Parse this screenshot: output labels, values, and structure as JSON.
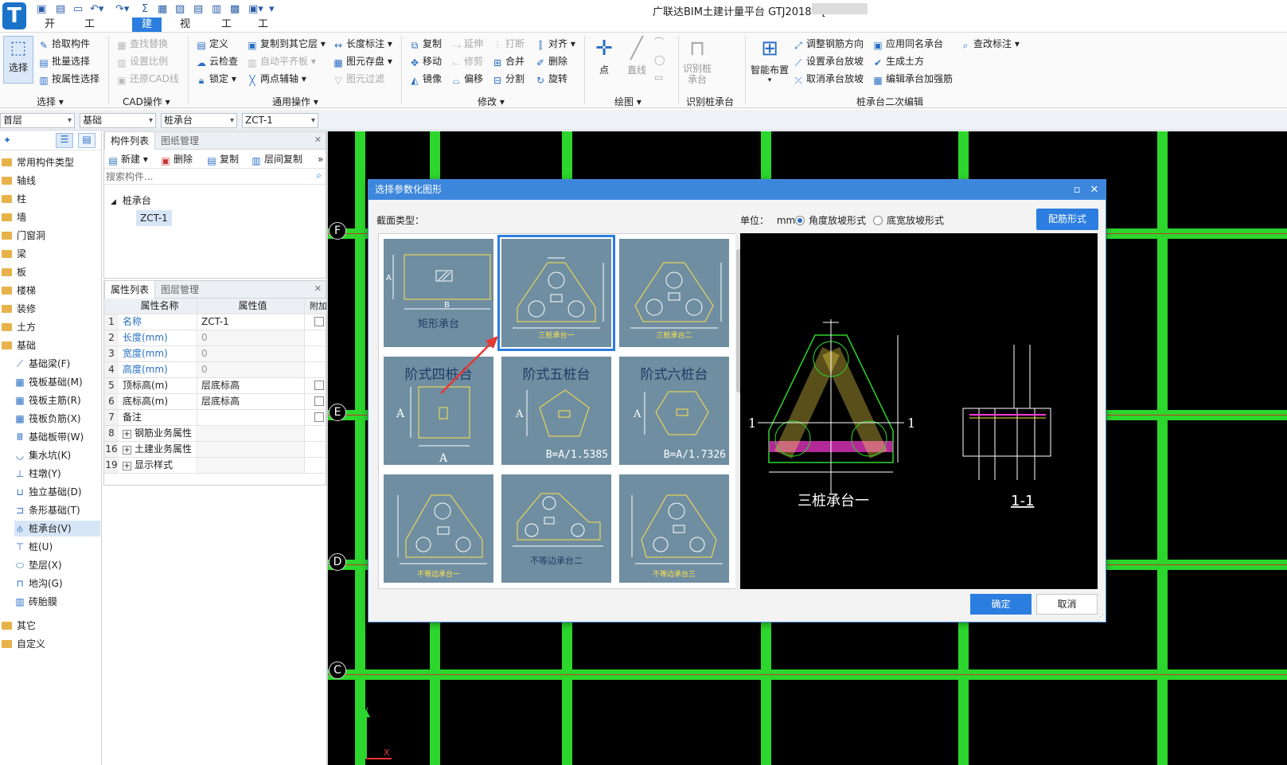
{
  "window": {
    "title": "广联达BIM土建计量平台 GTJ2018 - [",
    "logo": "T"
  },
  "menu": [
    "开始",
    "工程设置",
    "建模",
    "视图",
    "工具",
    "工程量"
  ],
  "menu_active": "建模",
  "ribbon": {
    "select": {
      "label": "选择",
      "pick": "拾取构件",
      "batch": "批量选择",
      "by_prop": "按属性选择",
      "group": "选择"
    },
    "cad": {
      "find_replace": "查找替换",
      "set_scale": "设置比例",
      "restore_cad": "还原CAD线",
      "group": "CAD操作"
    },
    "common": {
      "define": "定义",
      "cloud_check": "云检查",
      "lock": "锁定",
      "copy_layer": "复制到其它层",
      "auto_level": "自动平齐板",
      "two_point_axis": "两点辅轴",
      "len_mark": "长度标注",
      "save_elem": "图元存盘",
      "elem_filter": "图元过滤",
      "group": "通用操作"
    },
    "modify": {
      "copy": "复制",
      "move": "移动",
      "mirror": "镜像",
      "extend": "延伸",
      "trim": "修剪",
      "offset": "偏移",
      "break": "打断",
      "merge": "合并",
      "split": "分割",
      "align": "对齐",
      "delete": "删除",
      "rotate": "旋转",
      "group": "修改"
    },
    "draw": {
      "point": "点",
      "line": "直线",
      "group": "绘图"
    },
    "identify": {
      "label": "识别桩承台",
      "group": "识别桩承台"
    },
    "secondary": {
      "smart": "智能布置",
      "adjust_rebar": "调整钢筋方向",
      "set_slope": "设置承台放坡",
      "cancel_slope": "取消承台放坡",
      "apply_same": "应用同名承台",
      "gen_earth": "生成土方",
      "edit_reinf": "编辑承台加强筋",
      "view_mark": "查改标注",
      "group": "桩承台二次编辑"
    }
  },
  "selectors": [
    "首层",
    "基础",
    "桩承台",
    "ZCT-1"
  ],
  "tree": [
    "常用构件类型",
    "轴线",
    "柱",
    "墙",
    "门窗洞",
    "梁",
    "板",
    "楼梯",
    "装修",
    "土方",
    "基础",
    "基础梁(F)",
    "筏板基础(M)",
    "筏板主筋(R)",
    "筏板负筋(X)",
    "基础板带(W)",
    "集水坑(K)",
    "柱墩(Y)",
    "独立基础(D)",
    "条形基础(T)",
    "桩承台(V)",
    "桩(U)",
    "垫层(X)",
    "地沟(G)",
    "砖胎膜",
    "其它",
    "自定义"
  ],
  "component_panel": {
    "tab1": "构件列表",
    "tab2": "图纸管理",
    "new": "新建",
    "del": "删除",
    "copy": "复制",
    "layer_copy": "层间复制",
    "search_ph": "搜索构件...",
    "node": "桩承台",
    "leaf": "ZCT-1"
  },
  "prop_panel": {
    "tab1": "属性列表",
    "tab2": "图层管理",
    "headers": [
      "属性名称",
      "属性值",
      "附加"
    ],
    "rows": [
      {
        "idx": "1",
        "name": "名称",
        "value": "ZCT-1"
      },
      {
        "idx": "2",
        "name": "长度(mm)",
        "value": "0"
      },
      {
        "idx": "3",
        "name": "宽度(mm)",
        "value": "0"
      },
      {
        "idx": "4",
        "name": "高度(mm)",
        "value": "0"
      },
      {
        "idx": "5",
        "name": "顶标高(m)",
        "value": "层底标高"
      },
      {
        "idx": "6",
        "name": "底标高(m)",
        "value": "层底标高"
      },
      {
        "idx": "7",
        "name": "备注",
        "value": ""
      },
      {
        "idx": "8",
        "name": "钢筋业务属性",
        "value": ""
      },
      {
        "idx": "16",
        "name": "土建业务属性",
        "value": ""
      },
      {
        "idx": "19",
        "name": "显示样式",
        "value": ""
      }
    ]
  },
  "canvas": {
    "axis_labels": [
      "F",
      "E",
      "D",
      "C"
    ]
  },
  "dialog": {
    "title": "选择参数化图形",
    "section_type": "截面类型：",
    "unit_label": "单位：",
    "unit": "mm",
    "radio1": "角度放坡形式",
    "radio2": "底宽放坡形式",
    "config_btn": "配筋形式",
    "ok": "确定",
    "cancel": "取消",
    "shapes": [
      "矩形承台",
      "三桩承台一",
      "三桩承台二",
      "阶式四桩台",
      "阶式五桩台",
      "阶式六桩台",
      "不等边承台一",
      "不等边承台二",
      "不等边承台三"
    ],
    "ratio5": "B=A/1.5385",
    "ratio6": "B=A/1.7326",
    "preview_title": "三桩承台一",
    "section_mark": "1-1"
  }
}
